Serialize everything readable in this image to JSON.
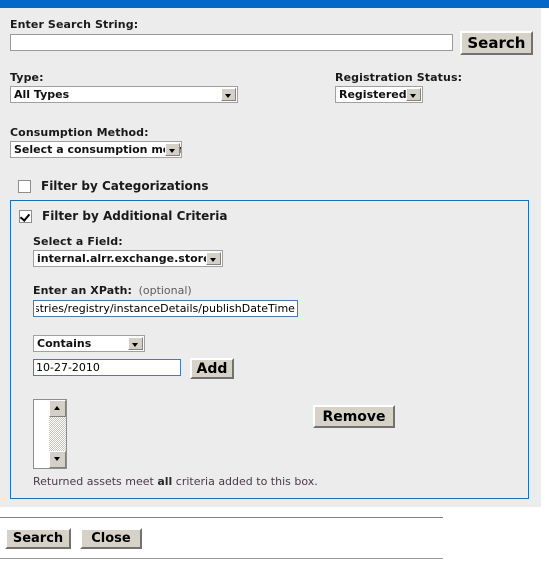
{
  "theme": {
    "accent_blue": "#0568c8",
    "panel_bg": "#ececec",
    "button_face": "#d6d2c8",
    "criteria_border": "#1a6fb5"
  },
  "search": {
    "label": "Enter Search String:",
    "value": "",
    "placeholder": "",
    "button_label": "Search"
  },
  "type": {
    "label": "Type:",
    "selected": "All Types"
  },
  "registration_status": {
    "label": "Registration Status:",
    "selected": "Registered"
  },
  "consumption_method": {
    "label": "Consumption Method:",
    "selected": "Select a consumption method"
  },
  "filter_categorizations": {
    "label": "Filter by Categorizations",
    "checked": false
  },
  "filter_additional_criteria": {
    "label": "Filter by Additional Criteria",
    "checked": true,
    "field": {
      "label": "Select a Field:",
      "selected": "internal.alrr.exchange.store"
    },
    "xpath": {
      "label": "Enter an XPath:",
      "optional_note": "(optional)",
      "value": "tings/registries/registry/instanceDetails/publishDateTime",
      "placeholder": ""
    },
    "operator": {
      "selected": "Contains"
    },
    "criteria_value": {
      "value": "10-27-2010",
      "placeholder": ""
    },
    "add_button_label": "Add",
    "remove_button_label": "Remove",
    "criteria_list": [],
    "note_prefix": "Returned assets meet ",
    "note_emphasis": "all",
    "note_suffix": " criteria added to this box."
  },
  "footer": {
    "search_label": "Search",
    "close_label": "Close"
  }
}
